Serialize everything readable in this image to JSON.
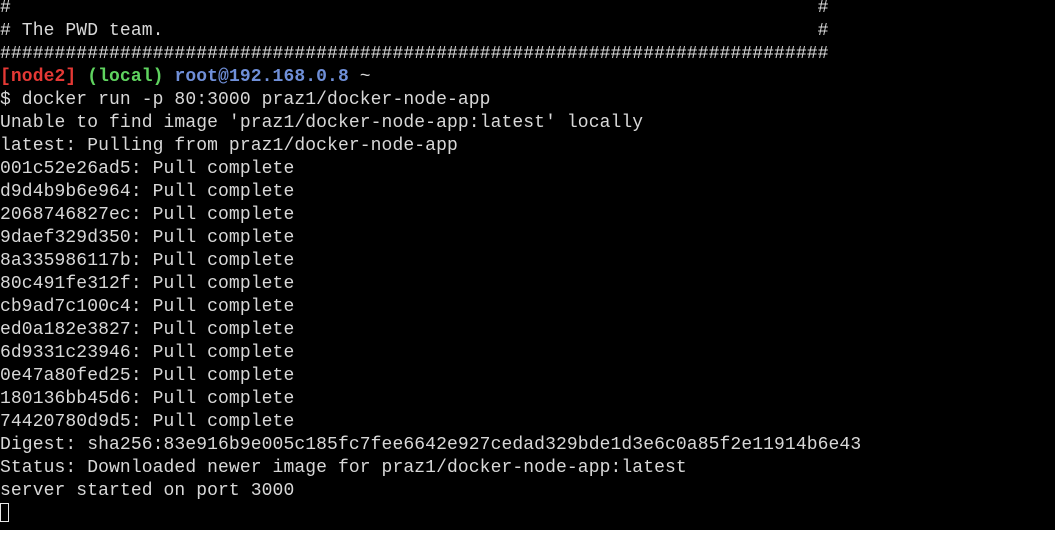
{
  "terminal": {
    "banner": [
      "#                                                                          #",
      "# The PWD team.                                                            #",
      "############################################################################"
    ],
    "prompt": {
      "host": "[node2]",
      "local": "(local)",
      "user_host": "root@192.168.0.8",
      "path": "~"
    },
    "command": "$ docker run -p 80:3000 praz1/docker-node-app",
    "output": [
      "Unable to find image 'praz1/docker-node-app:latest' locally",
      "latest: Pulling from praz1/docker-node-app",
      "001c52e26ad5: Pull complete",
      "d9d4b9b6e964: Pull complete",
      "2068746827ec: Pull complete",
      "9daef329d350: Pull complete",
      "8a335986117b: Pull complete",
      "80c491fe312f: Pull complete",
      "cb9ad7c100c4: Pull complete",
      "ed0a182e3827: Pull complete",
      "6d9331c23946: Pull complete",
      "0e47a80fed25: Pull complete",
      "180136bb45d6: Pull complete",
      "74420780d9d5: Pull complete",
      "Digest: sha256:83e916b9e005c185fc7fee6642e927cedad329bde1d3e6c0a85f2e11914b6e43",
      "Status: Downloaded newer image for praz1/docker-node-app:latest",
      "server started on port 3000"
    ]
  },
  "colors": {
    "background": "#000000",
    "text": "#d8d8d8",
    "host": "#e53935",
    "local": "#5fd35f",
    "user": "#6f8fd8"
  }
}
